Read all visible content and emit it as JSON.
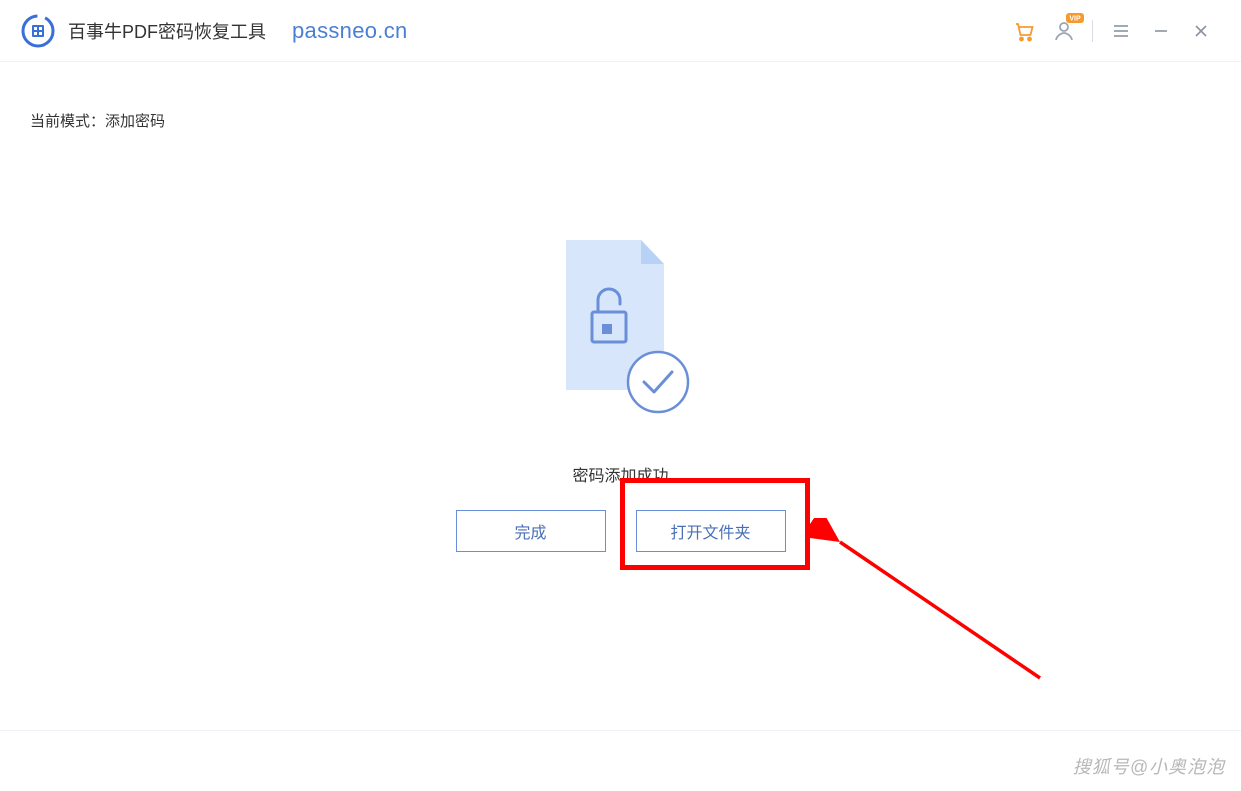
{
  "header": {
    "app_title": "百事牛PDF密码恢复工具",
    "domain": "passneo.cn"
  },
  "main": {
    "mode_label": "当前模式：添加密码",
    "status_text": "密码添加成功",
    "buttons": {
      "done": "完成",
      "open_folder": "打开文件夹"
    }
  },
  "watermark": "搜狐号@小奥泡泡",
  "colors": {
    "accent_blue": "#6a8fd8",
    "text_blue": "#4a7fd6",
    "highlight_red": "#ff0000",
    "orange_badge": "#f79a2e"
  },
  "icons": {
    "logo": "app-logo",
    "cart": "cart-icon",
    "user": "user-vip-icon",
    "menu": "menu-icon",
    "minimize": "minimize-icon",
    "close": "close-icon",
    "file_lock": "file-unlock-icon",
    "check": "check-icon"
  }
}
